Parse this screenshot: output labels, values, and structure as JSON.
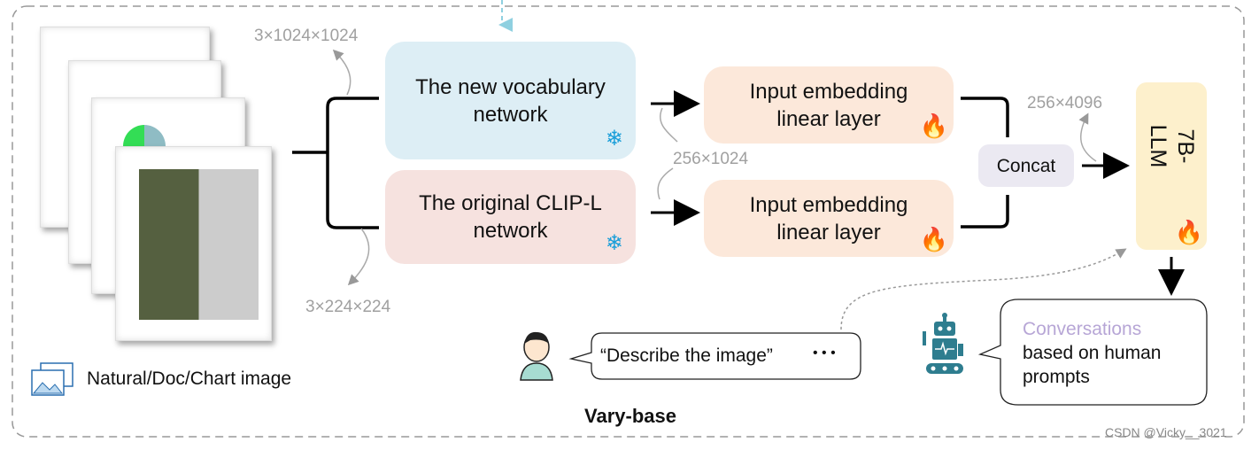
{
  "diagram_title": "Vary-base",
  "input": {
    "label": "Natural/Doc/Chart image",
    "icon": "image-stack-icon"
  },
  "dims": {
    "hi_res": "3×1024×1024",
    "low_res": "3×224×224",
    "tokens": "256×1024",
    "concat_out": "256×4096"
  },
  "boxes": {
    "new_vocab": {
      "line1": "The new vocabulary",
      "line2": "network",
      "color": "#ddeef5"
    },
    "clip": {
      "line1": "The original CLIP-L",
      "line2": "network",
      "color": "#f6e2df"
    },
    "emb1": {
      "line1": "Input embedding",
      "line2": "linear layer",
      "color": "#fce8da"
    },
    "emb2": {
      "line1": "Input embedding",
      "line2": "linear layer",
      "color": "#fce8da"
    },
    "concat": {
      "label": "Concat",
      "color": "#ebe9f2"
    },
    "llm": {
      "label": "7B-LLM",
      "color": "#fdf0cc"
    }
  },
  "prompt": {
    "text": "“Describe the image”",
    "ellipsis": "• • •"
  },
  "output": {
    "line1": "Conversations",
    "line2": "based on human",
    "line3": "prompts",
    "accent": "#b7a6d6"
  },
  "watermark": "CSDN @Vicky__3021",
  "icons": {
    "frozen": "snowflake-icon",
    "trainable": "flame-icon",
    "user": "person-icon",
    "bot": "robot-icon"
  }
}
